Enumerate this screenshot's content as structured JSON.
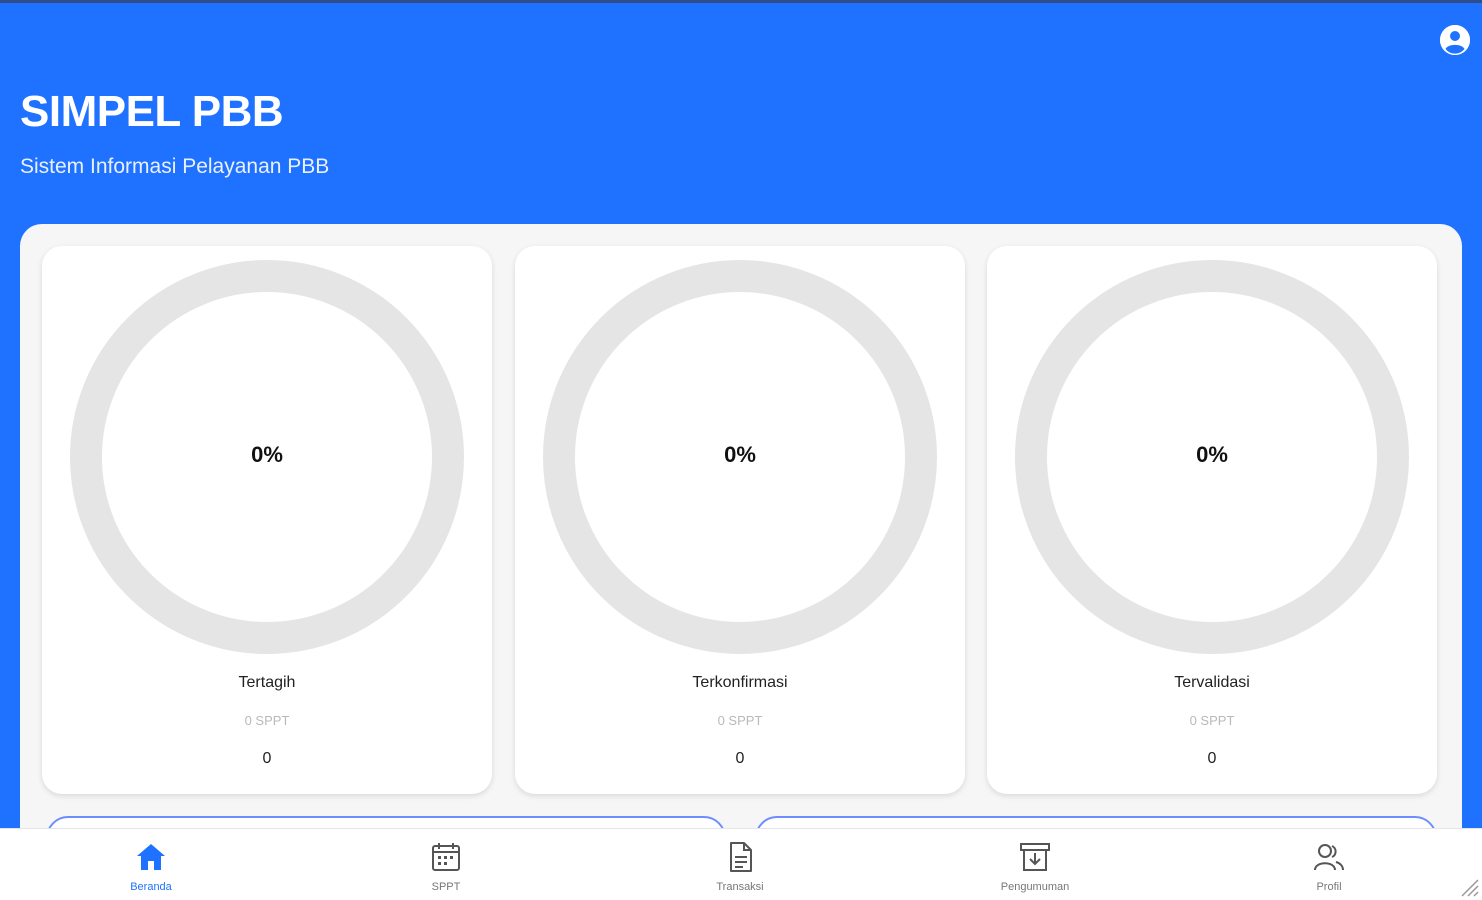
{
  "header": {
    "title": "SIMPEL PBB",
    "subtitle": "Sistem Informasi Pelayanan PBB"
  },
  "stats": [
    {
      "percent_label": "0%",
      "percent": 0,
      "label": "Tertagih",
      "count": "0 SPPT",
      "value": "0"
    },
    {
      "percent_label": "0%",
      "percent": 0,
      "label": "Terkonfirmasi",
      "count": "0 SPPT",
      "value": "0"
    },
    {
      "percent_label": "0%",
      "percent": 0,
      "label": "Tervalidasi",
      "count": "0 SPPT",
      "value": "0"
    }
  ],
  "nav": {
    "items": [
      {
        "label": "Beranda",
        "icon": "home-icon",
        "active": true
      },
      {
        "label": "SPPT",
        "icon": "calendar-icon",
        "active": false
      },
      {
        "label": "Transaksi",
        "icon": "document-icon",
        "active": false
      },
      {
        "label": "Pengumuman",
        "icon": "archive-icon",
        "active": false
      },
      {
        "label": "Profil",
        "icon": "users-icon",
        "active": false
      }
    ]
  },
  "colors": {
    "primary": "#1f72ff",
    "ring_track": "#e5e5e5",
    "panel": "#f6f6f6",
    "inactive": "#777777"
  }
}
